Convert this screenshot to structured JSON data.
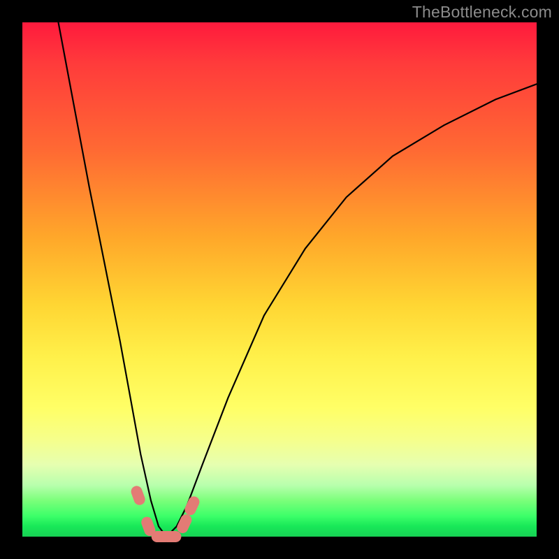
{
  "watermark": "TheBottleneck.com",
  "chart_data": {
    "type": "line",
    "title": "",
    "xlabel": "",
    "ylabel": "",
    "xlim": [
      0,
      100
    ],
    "ylim": [
      0,
      100
    ],
    "grid": false,
    "legend": false,
    "series": [
      {
        "name": "curve",
        "x": [
          7,
          10,
          13,
          16,
          19,
          21,
          23,
          25,
          26.5,
          28,
          30,
          32,
          35,
          40,
          47,
          55,
          63,
          72,
          82,
          92,
          100
        ],
        "values": [
          100,
          84,
          68,
          53,
          38,
          27,
          16,
          7,
          2,
          0,
          2,
          6,
          14,
          27,
          43,
          56,
          66,
          74,
          80,
          85,
          88
        ]
      }
    ],
    "markers": [
      {
        "name": "marker-left-upper",
        "x": 22.5,
        "y": 8,
        "color": "#e37b75"
      },
      {
        "name": "marker-left-lower",
        "x": 24.5,
        "y": 2,
        "color": "#e37b75"
      },
      {
        "name": "marker-valley-a",
        "x": 27.0,
        "y": 0,
        "color": "#e37b75"
      },
      {
        "name": "marker-valley-b",
        "x": 29.0,
        "y": 0,
        "color": "#e37b75"
      },
      {
        "name": "marker-right-lower",
        "x": 31.5,
        "y": 2.5,
        "color": "#e37b75"
      },
      {
        "name": "marker-right-upper",
        "x": 33.0,
        "y": 6,
        "color": "#e37b75"
      }
    ],
    "colors": {
      "curve_stroke": "#000000",
      "marker_fill": "#e37b75",
      "background_top": "#ff1a3d",
      "background_bottom": "#17d154",
      "frame": "#000000",
      "watermark": "#8c8c8c"
    }
  }
}
